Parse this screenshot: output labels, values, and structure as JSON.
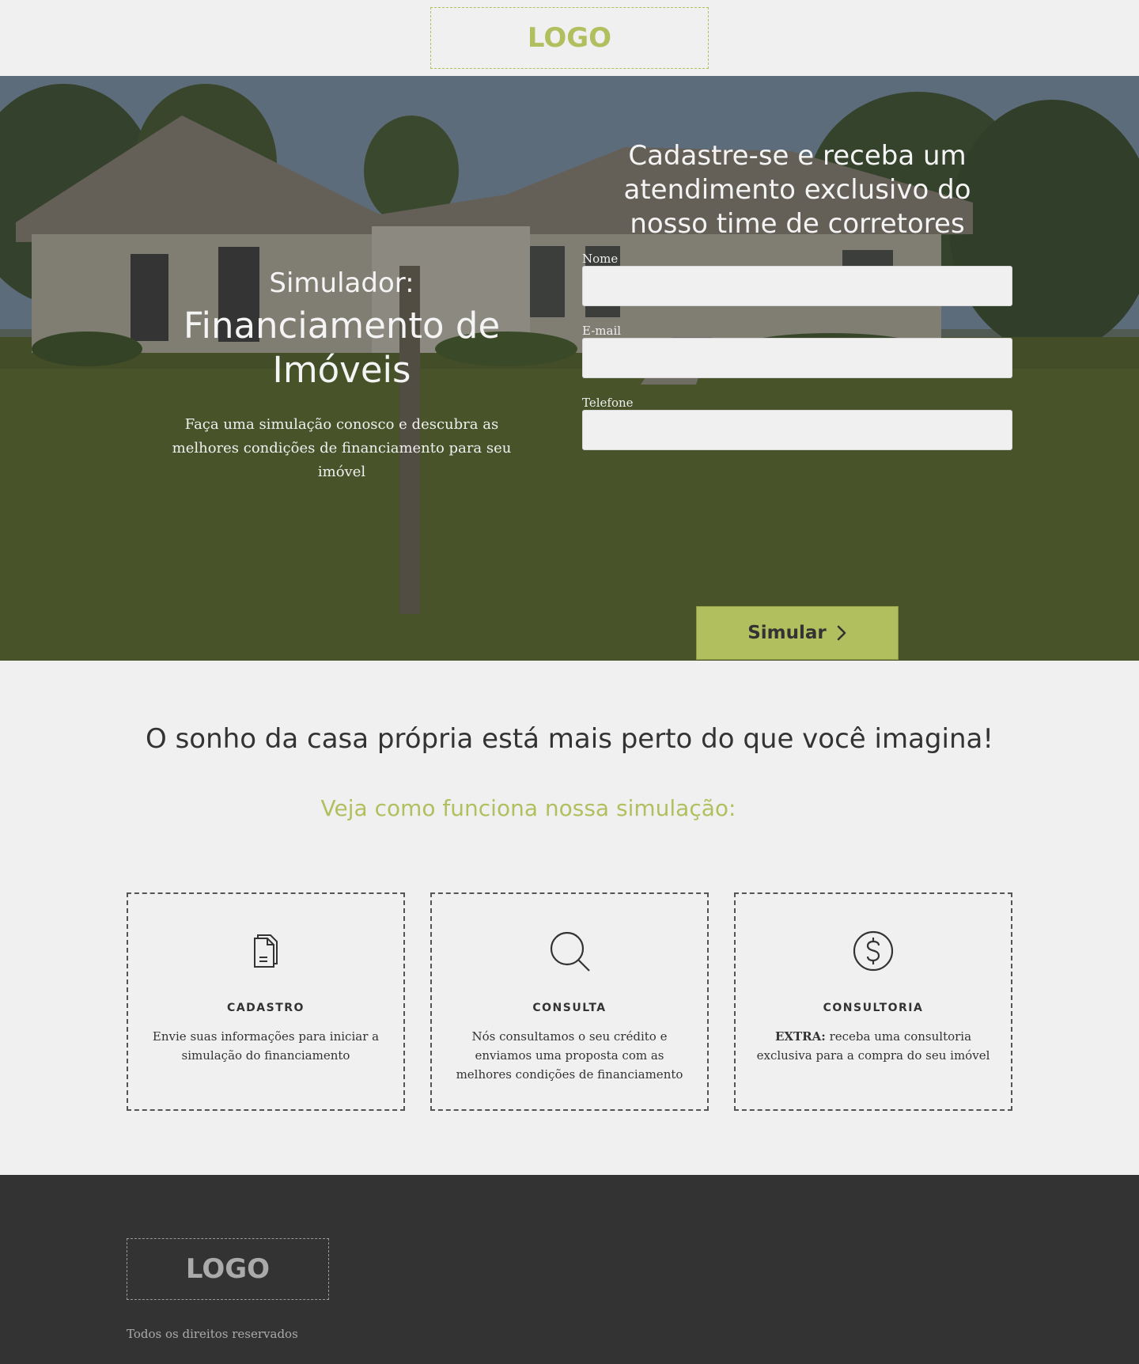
{
  "header": {
    "logo": "LOGO"
  },
  "hero": {
    "pre_title": "Simulador:",
    "title": "Financiamento de Imóveis",
    "subtitle": "Faça uma simulação conosco e descubra as melhores condições de financiamento para seu imóvel",
    "form": {
      "title": "Cadastre-se e receba um atendimento exclusivo do nosso time de corretores",
      "fields": [
        {
          "label": "Nome",
          "value": ""
        },
        {
          "label": "E-mail",
          "value": ""
        },
        {
          "label": "Telefone",
          "value": ""
        }
      ],
      "submit_label": "Simular"
    }
  },
  "section": {
    "heading": "O sonho da casa própria está mais perto do que você imagina!",
    "subheading": "Veja como funciona nossa simulação:",
    "cards": [
      {
        "icon": "document-icon",
        "title": "CADASTRO",
        "text": "Envie suas informações para iniciar a simulação do financiamento"
      },
      {
        "icon": "search-icon",
        "title": "CONSULTA",
        "text": "Nós consultamos o seu crédito e enviamos uma proposta com as melhores condições de financiamento"
      },
      {
        "icon": "dollar-icon",
        "title": "CONSULTORIA",
        "text_bold": "EXTRA:",
        "text": " receba uma consultoria exclusiva para a compra do seu imóvel"
      }
    ]
  },
  "footer": {
    "logo": "LOGO",
    "copyright": "Todos os direitos reservados"
  },
  "colors": {
    "accent": "#b2bf5e",
    "dark": "#333333",
    "background": "#f0f0f0"
  }
}
